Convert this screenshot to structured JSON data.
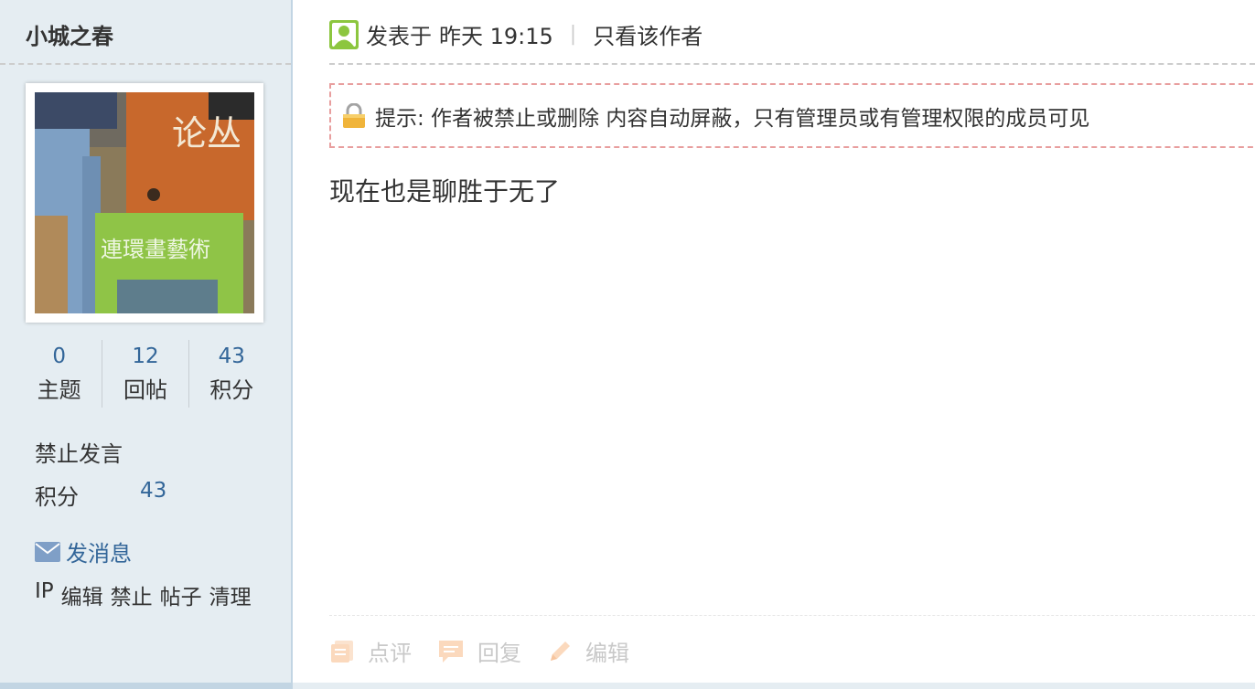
{
  "author": {
    "name": "小城之春",
    "stats": [
      {
        "value": "0",
        "label": "主题"
      },
      {
        "value": "12",
        "label": "回帖"
      },
      {
        "value": "43",
        "label": "积分"
      }
    ],
    "group": "禁止发言",
    "score_label": "积分",
    "score_value": "43",
    "send_message": "发消息",
    "admin_links": [
      "IP",
      "编辑",
      "禁止",
      "帖子",
      "清理"
    ]
  },
  "post": {
    "posted_prefix": "发表于",
    "posted_time": "昨天 19:15",
    "only_author": "只看该作者",
    "notice": "提示: 作者被禁止或删除 内容自动屏蔽，只有管理员或有管理权限的成员可见",
    "body": "现在也是聊胜于无了"
  },
  "actions": [
    {
      "label": "点评",
      "icon": "comment-icon"
    },
    {
      "label": "回复",
      "icon": "reply-icon"
    },
    {
      "label": "编辑",
      "icon": "pencil-icon"
    }
  ],
  "colors": {
    "sidebar_bg": "#e5edf2",
    "link_blue": "#336699",
    "notice_border": "#e89e9e",
    "action_gray": "#c9c9c9"
  }
}
